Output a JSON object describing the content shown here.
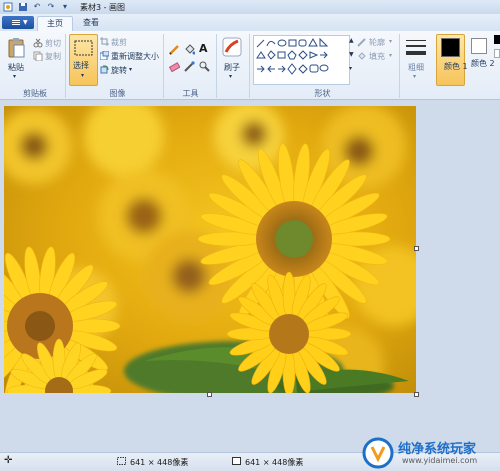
{
  "window": {
    "title": "素材3 - 画图"
  },
  "tabs": [
    {
      "label": "主页"
    },
    {
      "label": "查看"
    }
  ],
  "clipboard": {
    "paste": "粘贴",
    "cut": "剪切",
    "copy": "复制",
    "group": "剪贴板"
  },
  "image": {
    "select": "选择",
    "crop": "裁剪",
    "resize": "重新调整大小",
    "rotate": "旋转",
    "group": "图像"
  },
  "tools": {
    "group": "工具"
  },
  "brushes": {
    "label": "刷子"
  },
  "shapes": {
    "outline": "轮廓",
    "fill": "填充",
    "group": "形状"
  },
  "size": {
    "label": "粗细"
  },
  "colors": {
    "color1_label": "颜色 1",
    "color1": "#000000",
    "color2_label": "颜色 2",
    "color2": "#ffffff"
  },
  "status": {
    "selection_size": "641 × 448像素",
    "image_size": "641 × 448像素"
  },
  "watermark": {
    "name": "纯净系统玩家",
    "url": "www.yidaimei.com"
  }
}
